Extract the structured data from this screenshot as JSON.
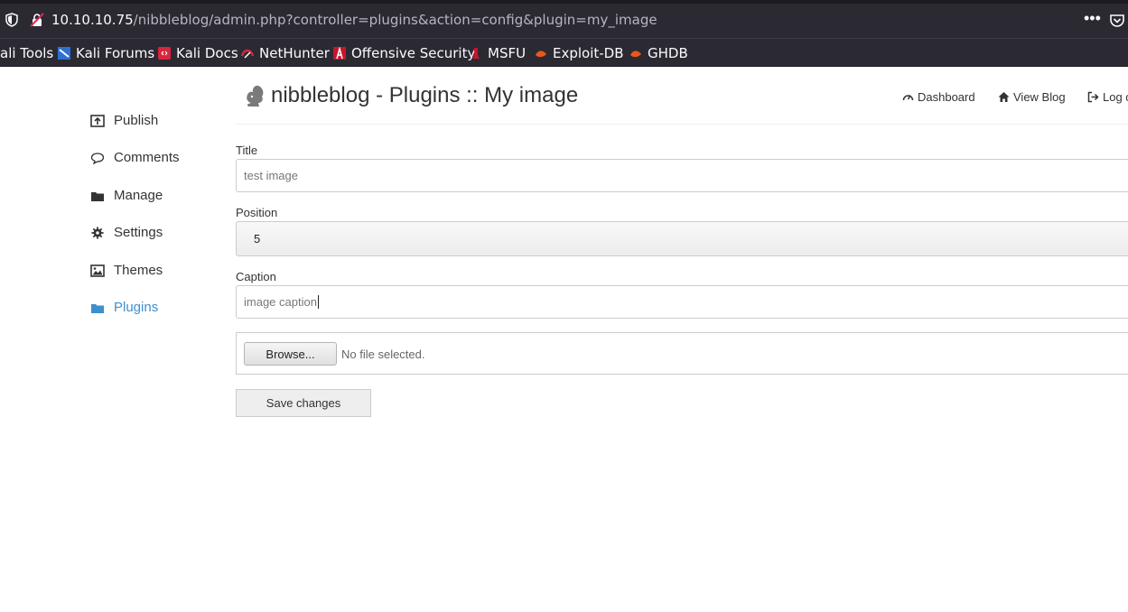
{
  "browser": {
    "url_host": "10.10.10.75",
    "url_path": "/nibbleblog/admin.php?controller=plugins&action=config&plugin=my_image",
    "more_glyph": "•••",
    "bookmarks": [
      {
        "label": "ali Tools",
        "icon": "kali-tools-icon"
      },
      {
        "label": "Kali Forums",
        "icon": "kali-forums-icon"
      },
      {
        "label": "Kali Docs",
        "icon": "kali-docs-icon"
      },
      {
        "label": "NetHunter",
        "icon": "nethunter-icon"
      },
      {
        "label": "Offensive Security",
        "icon": "offsec-icon"
      },
      {
        "label": "MSFU",
        "icon": "msfu-icon"
      },
      {
        "label": "Exploit-DB",
        "icon": "exploit-db-icon"
      },
      {
        "label": "GHDB",
        "icon": "ghdb-icon"
      }
    ]
  },
  "sidebar": {
    "items": [
      {
        "label": "Publish",
        "icon": "publish-icon"
      },
      {
        "label": "Comments",
        "icon": "comment-icon"
      },
      {
        "label": "Manage",
        "icon": "folder-icon"
      },
      {
        "label": "Settings",
        "icon": "gear-icon"
      },
      {
        "label": "Themes",
        "icon": "image-icon"
      },
      {
        "label": "Plugins",
        "icon": "folder-open-icon",
        "active": true
      }
    ]
  },
  "header": {
    "title": "nibbleblog - Plugins :: My image",
    "links": [
      {
        "label": "Dashboard",
        "icon": "dashboard-icon"
      },
      {
        "label": "View Blog",
        "icon": "home-icon"
      },
      {
        "label": "Log o",
        "icon": "logout-icon"
      }
    ]
  },
  "form": {
    "title_label": "Title",
    "title_value": "test image",
    "position_label": "Position",
    "position_value": "5",
    "caption_label": "Caption",
    "caption_value": "image caption",
    "browse_label": "Browse...",
    "file_status": "No file selected.",
    "save_label": "Save changes"
  },
  "colors": {
    "active_link": "#3d8fcf",
    "browser_chrome": "#2b2a33"
  }
}
